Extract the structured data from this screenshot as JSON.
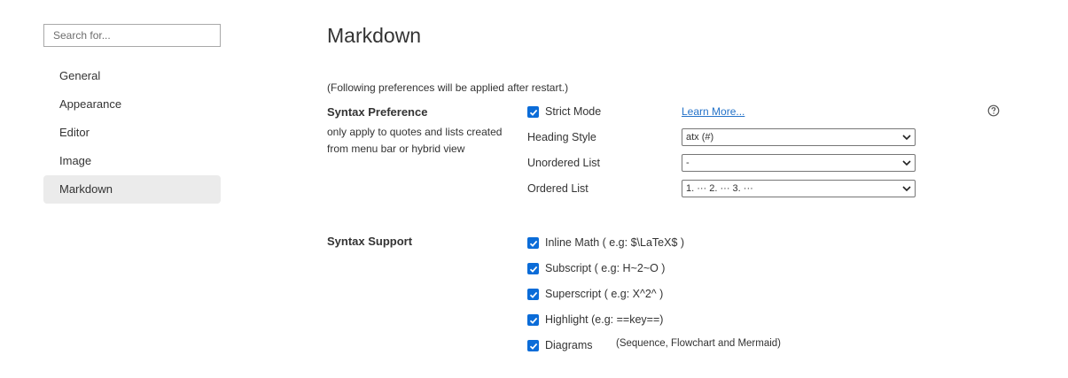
{
  "search": {
    "placeholder": "Search for..."
  },
  "sidebar": {
    "items": [
      {
        "label": "General",
        "active": false
      },
      {
        "label": "Appearance",
        "active": false
      },
      {
        "label": "Editor",
        "active": false
      },
      {
        "label": "Image",
        "active": false
      },
      {
        "label": "Markdown",
        "active": true
      }
    ]
  },
  "main": {
    "title": "Markdown",
    "restart_note": "(Following preferences will be applied after restart.)",
    "syntax_preference": {
      "title": "Syntax Preference",
      "description": "only apply to quotes and lists created from menu bar or hybrid view",
      "strict_mode": {
        "label": "Strict Mode",
        "checked": true
      },
      "learn_more": "Learn More...",
      "help_icon": "question-circle-icon",
      "heading_style": {
        "label": "Heading Style",
        "value": "atx (#)"
      },
      "unordered_list": {
        "label": "Unordered List",
        "value": "-"
      },
      "ordered_list": {
        "label": "Ordered List",
        "value": "1. ··· 2. ··· 3. ···"
      }
    },
    "syntax_support": {
      "title": "Syntax Support",
      "options": [
        {
          "label": "Inline Math ( e.g: $\\LaTeX$ )",
          "checked": true
        },
        {
          "label": "Subscript ( e.g: H~2~O )",
          "checked": true
        },
        {
          "label": "Superscript ( e.g: X^2^ )",
          "checked": true
        },
        {
          "label": "Highlight (e.g: ==key==)",
          "checked": true
        },
        {
          "label": "Diagrams",
          "checked": true
        }
      ],
      "diagrams_note": "(Sequence, Flowchart and Mermaid)"
    }
  },
  "colors": {
    "accent": "#0b6cd8",
    "link": "#2573c9",
    "active_nav_bg": "#ebebeb",
    "text": "#333333"
  }
}
